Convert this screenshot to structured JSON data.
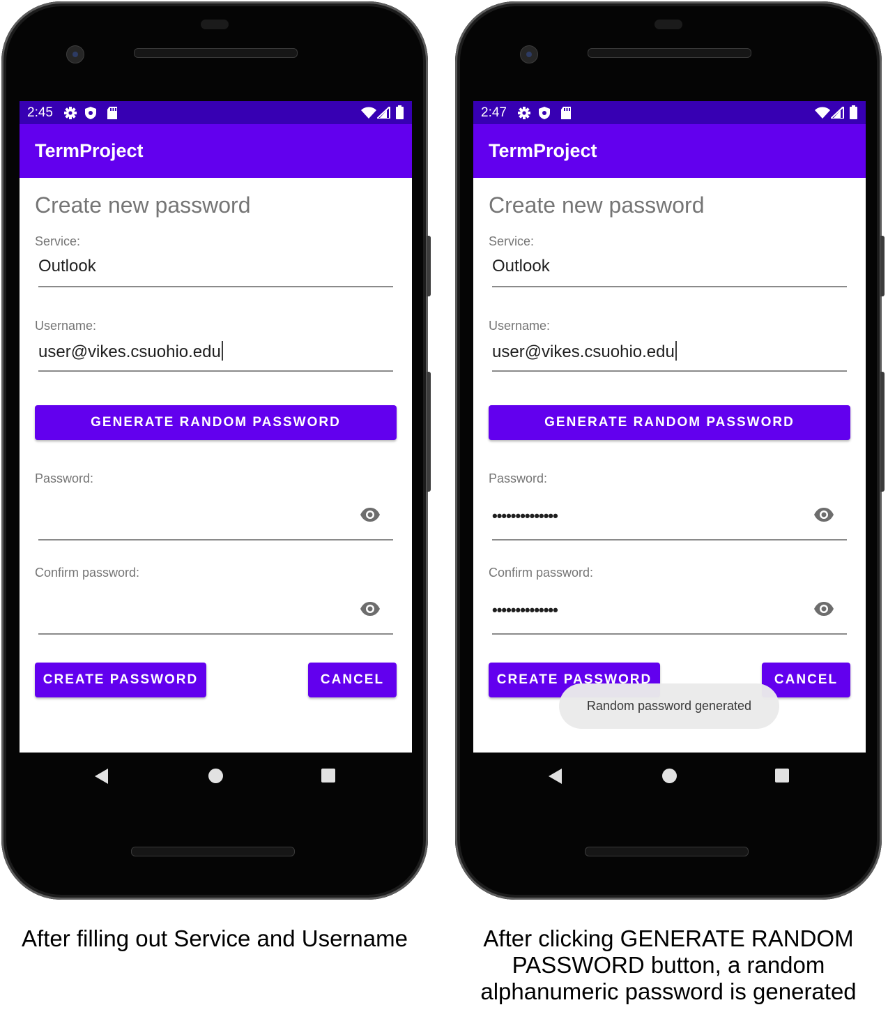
{
  "left": {
    "status_time": "2:45",
    "app_title": "TermProject",
    "heading": "Create new password",
    "service_label": "Service:",
    "service_value": "Outlook",
    "username_label": "Username:",
    "username_value": "user@vikes.csuohio.edu",
    "generate_label": "GENERATE RANDOM PASSWORD",
    "password_label": "Password:",
    "password_value": "",
    "confirm_label": "Confirm password:",
    "confirm_value": "",
    "create_label": "CREATE PASSWORD",
    "cancel_label": "CANCEL",
    "caption": "After filling out Service and Username"
  },
  "right": {
    "status_time": "2:47",
    "app_title": "TermProject",
    "heading": "Create new password",
    "service_label": "Service:",
    "service_value": "Outlook",
    "username_label": "Username:",
    "username_value": "user@vikes.csuohio.edu",
    "generate_label": "GENERATE RANDOM PASSWORD",
    "password_label": "Password:",
    "password_value": "••••••••••••••",
    "confirm_label": "Confirm password:",
    "confirm_value": "••••••••••••••",
    "create_label": "CREATE PASSWORD",
    "cancel_label": "CANCEL",
    "toast": "Random password generated",
    "caption": "After clicking GENERATE RANDOM PASSWORD button, a random alphanumeric password is generated"
  },
  "colors": {
    "status_bar": "#3700b3",
    "app_bar": "#6200ee",
    "button": "#6200ee",
    "toast_bg": "#ebebeb"
  },
  "icons": [
    "gear-icon",
    "shield-icon",
    "sd-card-icon",
    "wifi-icon",
    "signal-icon",
    "battery-icon",
    "eye-icon",
    "back-icon",
    "home-icon",
    "recents-icon"
  ]
}
